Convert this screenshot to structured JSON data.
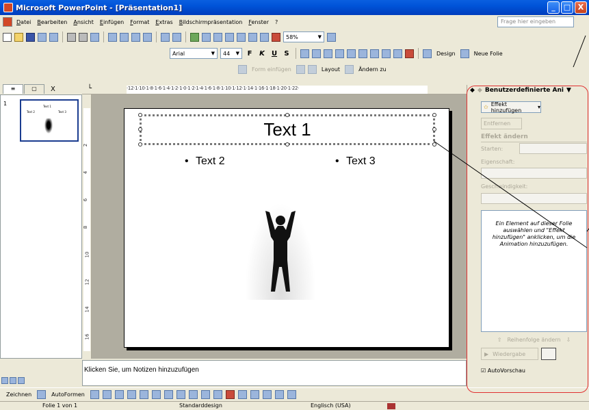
{
  "window": {
    "title": "Microsoft PowerPoint - [Präsentation1]",
    "buttons": [
      "_",
      "□",
      "X"
    ]
  },
  "menu": {
    "items": [
      "Datei",
      "Bearbeiten",
      "Ansicht",
      "Einfügen",
      "Format",
      "Extras",
      "Bildschirmpräsentation",
      "Fenster",
      "?"
    ],
    "help_placeholder": "Frage hier eingeben"
  },
  "toolbar": {
    "zoom": "58%",
    "font": "Arial",
    "font_size": "44",
    "bold": "F",
    "italic": "K",
    "underline": "U",
    "shadow": "S",
    "design_label": "Design",
    "new_slide_label": "Neue Folie",
    "insert_shape_label": "Form einfügen",
    "layout_label": "Layout",
    "change_to_label": "Ändern zu"
  },
  "tabs": {
    "close": "X"
  },
  "thumbnail": {
    "number": "1",
    "title": "Text 1",
    "b1": "Text 2",
    "b2": "Text 3"
  },
  "ruler": {
    "h": "·12·1·10·1·8·1·6·1·4·1·2·1·0·1·2·1·4·1·6·1·8·1·10·1·12·1·14·1·16·1·18·1·20·1·22·",
    "v": [
      "2",
      "4",
      "6",
      "8",
      "10",
      "12",
      "14",
      "16"
    ]
  },
  "slide": {
    "title": "Text 1",
    "bullet1": "Text 2",
    "bullet2": "Text 3"
  },
  "notes": {
    "placeholder": "Klicken Sie, um Notizen hinzuzufügen"
  },
  "drawing": {
    "draw_label": "Zeichnen",
    "autoshapes_label": "AutoFormen"
  },
  "status": {
    "slide": "Folie 1 von 1",
    "design": "Standarddesign",
    "language": "Englisch (USA)"
  },
  "taskpane": {
    "title": "Benutzerdefinierte Ani",
    "add_effect": "Effekt hinzufügen",
    "remove": "Entfernen",
    "section": "Effekt ändern",
    "start_label": "Starten:",
    "property_label": "Eigenschaft:",
    "speed_label": "Geschwindigkeit:",
    "list_hint": "Ein Element auf dieser Folie auswählen und \"Effekt hinzufügen\" anklicken, um die Animation hinzuzufügen.",
    "reorder": "Reihenfolge ändern",
    "play": "Wiedergabe",
    "autopreview": "AutoVorschau"
  },
  "colors": {
    "highlight": "#e03030",
    "titlebar": "#0053d8",
    "accent": "#1a3c8f"
  }
}
